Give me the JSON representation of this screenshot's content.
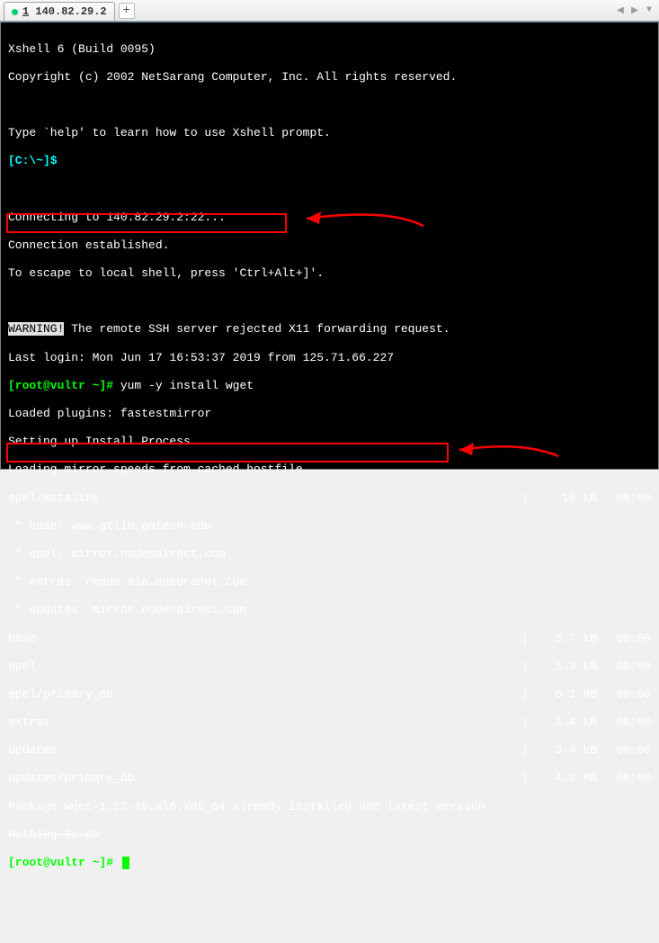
{
  "tab": {
    "num": "1",
    "label": "140.82.29.2"
  },
  "header": {
    "title": "Xshell 6 (Build 0095)",
    "copyright": "Copyright (c) 2002 NetSarang Computer, Inc. All rights reserved."
  },
  "help_line": "Type `help' to learn how to use Xshell prompt.",
  "local_prompt": "[C:\\~]$",
  "connecting": {
    "l1": "Connecting to 140.82.29.2:22...",
    "l2": "Connection established.",
    "l3": "To escape to local shell, press 'Ctrl+Alt+]'."
  },
  "warning_tag": "WARNING!",
  "warning_msg": " The remote SSH server rejected X11 forwarding request.",
  "last_login": "Last login: Mon Jun 17 16:53:37 2019 from 125.71.66.227",
  "prompt1": {
    "user": "[root@vultr ~]#",
    "cmd": " yum -y install wget"
  },
  "yum": {
    "l1": "Loaded plugins: fastestmirror",
    "l2": "Setting up Install Process",
    "l3": "Loading mirror speeds from cached hostfile"
  },
  "mirrors": {
    "base": " * base: www.gtlib.gatech.edu",
    "epel_m": " * epel: mirror.nodesdirect.com",
    "extras_m": " * extras: repos.mia.quadranet.com",
    "updates_m": " * updates: mirror.nodesdirect.com"
  },
  "rows": [
    {
      "name": "epel/metalink",
      "size": "19 kB",
      "time": "00:00"
    },
    {
      "name": "base",
      "size": "3.7 kB",
      "time": "00:00"
    },
    {
      "name": "epel",
      "size": "5.3 kB",
      "time": "00:00"
    },
    {
      "name": "epel/primary_db",
      "size": "6.1 MB",
      "time": "00:00"
    },
    {
      "name": "extras",
      "size": "3.4 kB",
      "time": "00:00"
    },
    {
      "name": "updates",
      "size": "3.4 kB",
      "time": "00:00"
    },
    {
      "name": "updates/primary_db",
      "size": "4.2 MB",
      "time": "00:00"
    }
  ],
  "result": {
    "l1": "Package wget-1.12-10.el6.x86_64 already installed and latest version",
    "l2": "Nothing to do"
  },
  "prompt2": {
    "user": "[root@vultr ~]#"
  }
}
